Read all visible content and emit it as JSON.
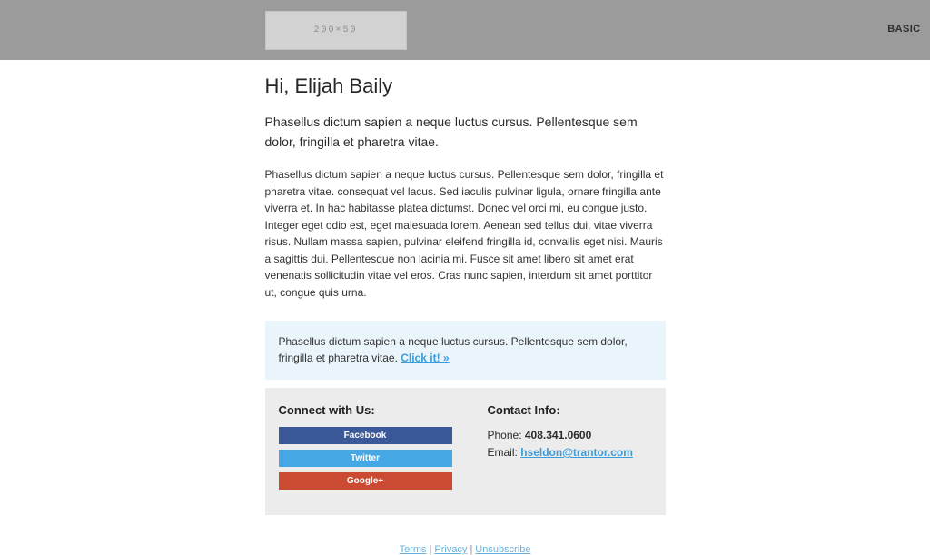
{
  "header": {
    "logo_placeholder_text": "200×50",
    "plan_label": "BASIC"
  },
  "main": {
    "greeting": "Hi, Elijah Baily",
    "lead": "Phasellus dictum sapien a neque luctus cursus. Pellentesque sem dolor, fringilla et pharetra vitae.",
    "body": "Phasellus dictum sapien a neque luctus cursus. Pellentesque sem dolor, fringilla et pharetra vitae. consequat vel lacus. Sed iaculis pulvinar ligula, ornare fringilla ante viverra et. In hac habitasse platea dictumst. Donec vel orci mi, eu congue justo. Integer eget odio est, eget malesuada lorem. Aenean sed tellus dui, vitae viverra risus. Nullam massa sapien, pulvinar eleifend fringilla id, convallis eget nisi. Mauris a sagittis dui. Pellentesque non lacinia mi. Fusce sit amet libero sit amet erat venenatis sollicitudin vitae vel eros. Cras nunc sapien, interdum sit amet porttitor ut, congue quis urna."
  },
  "callout": {
    "text": "Phasellus dictum sapien a neque luctus cursus. Pellentesque sem dolor, fringilla et pharetra vitae. ",
    "link_label": "Click it! »"
  },
  "panel": {
    "connect_title": "Connect with Us:",
    "social": [
      {
        "label": "Facebook",
        "color": "#3b5998"
      },
      {
        "label": "Twitter",
        "color": "#45a7e4"
      },
      {
        "label": "Google+",
        "color": "#cb4b32"
      }
    ],
    "contact_title": "Contact Info:",
    "phone_label": "Phone: ",
    "phone_value": "408.341.0600",
    "email_label": "Email: ",
    "email_value": "hseldon@trantor.com"
  },
  "footer": {
    "terms": "Terms",
    "privacy": "Privacy",
    "unsubscribe": "Unsubscribe",
    "separator": "|"
  }
}
